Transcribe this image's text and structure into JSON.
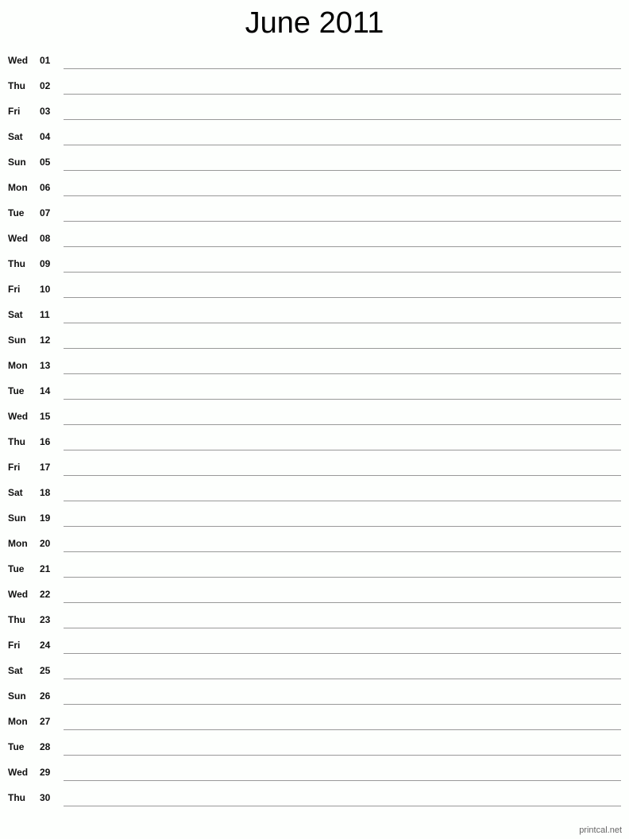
{
  "title": "June 2011",
  "days": [
    {
      "dow": "Wed",
      "day": "01"
    },
    {
      "dow": "Thu",
      "day": "02"
    },
    {
      "dow": "Fri",
      "day": "03"
    },
    {
      "dow": "Sat",
      "day": "04"
    },
    {
      "dow": "Sun",
      "day": "05"
    },
    {
      "dow": "Mon",
      "day": "06"
    },
    {
      "dow": "Tue",
      "day": "07"
    },
    {
      "dow": "Wed",
      "day": "08"
    },
    {
      "dow": "Thu",
      "day": "09"
    },
    {
      "dow": "Fri",
      "day": "10"
    },
    {
      "dow": "Sat",
      "day": "11"
    },
    {
      "dow": "Sun",
      "day": "12"
    },
    {
      "dow": "Mon",
      "day": "13"
    },
    {
      "dow": "Tue",
      "day": "14"
    },
    {
      "dow": "Wed",
      "day": "15"
    },
    {
      "dow": "Thu",
      "day": "16"
    },
    {
      "dow": "Fri",
      "day": "17"
    },
    {
      "dow": "Sat",
      "day": "18"
    },
    {
      "dow": "Sun",
      "day": "19"
    },
    {
      "dow": "Mon",
      "day": "20"
    },
    {
      "dow": "Tue",
      "day": "21"
    },
    {
      "dow": "Wed",
      "day": "22"
    },
    {
      "dow": "Thu",
      "day": "23"
    },
    {
      "dow": "Fri",
      "day": "24"
    },
    {
      "dow": "Sat",
      "day": "25"
    },
    {
      "dow": "Sun",
      "day": "26"
    },
    {
      "dow": "Mon",
      "day": "27"
    },
    {
      "dow": "Tue",
      "day": "28"
    },
    {
      "dow": "Wed",
      "day": "29"
    },
    {
      "dow": "Thu",
      "day": "30"
    }
  ],
  "footer": "printcal.net"
}
